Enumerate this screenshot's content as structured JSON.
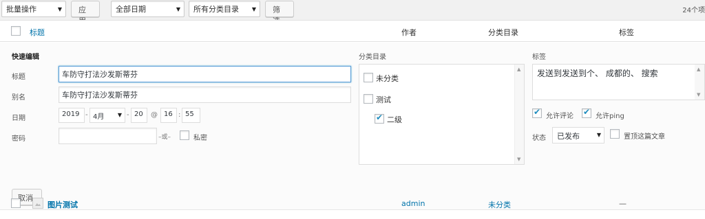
{
  "toolbar": {
    "bulk_actions": "批量操作",
    "apply": "应用",
    "date_filter": "全部日期",
    "category_filter": "所有分类目录",
    "filter": "筛选",
    "item_count": "24个项"
  },
  "table": {
    "columns": {
      "title": "标题",
      "author": "作者",
      "categories": "分类目录",
      "tags": "标签"
    }
  },
  "quick_edit": {
    "heading": "快速编辑",
    "title_label": "标题",
    "title_value": "车防守打法沙发斯蒂芬",
    "slug_label": "别名",
    "slug_value": "车防守打法沙发斯蒂芬",
    "date_label": "日期",
    "year": "2019",
    "month": "4月",
    "day": "20",
    "hour": "16",
    "minute": "55",
    "date_dash": "-",
    "time_at": "@",
    "time_colon": ":",
    "password_label": "密码",
    "password_value": "",
    "or_text": "–或–",
    "private_label": "私密",
    "categories_label": "分类目录",
    "categories": [
      {
        "name": "未分类",
        "checked": false
      },
      {
        "name": "测试",
        "checked": false
      },
      {
        "name": "二级",
        "checked": true
      }
    ],
    "tags_label": "标签",
    "tags_value": "发送到发送到个、 成都的、 搜索",
    "allow_comments": "允许评论",
    "allow_pings": "允许ping",
    "status_label": "状态",
    "status_value": "已发布",
    "sticky_label": "置顶这篇文章",
    "cancel": "取消"
  },
  "rows": [
    {
      "title": "图片测试",
      "author": "admin",
      "category": "未分类",
      "tags": "—"
    }
  ],
  "colors": {
    "link": "#0073aa",
    "focus": "#5b9dd9",
    "check": "#1e8cbe"
  }
}
